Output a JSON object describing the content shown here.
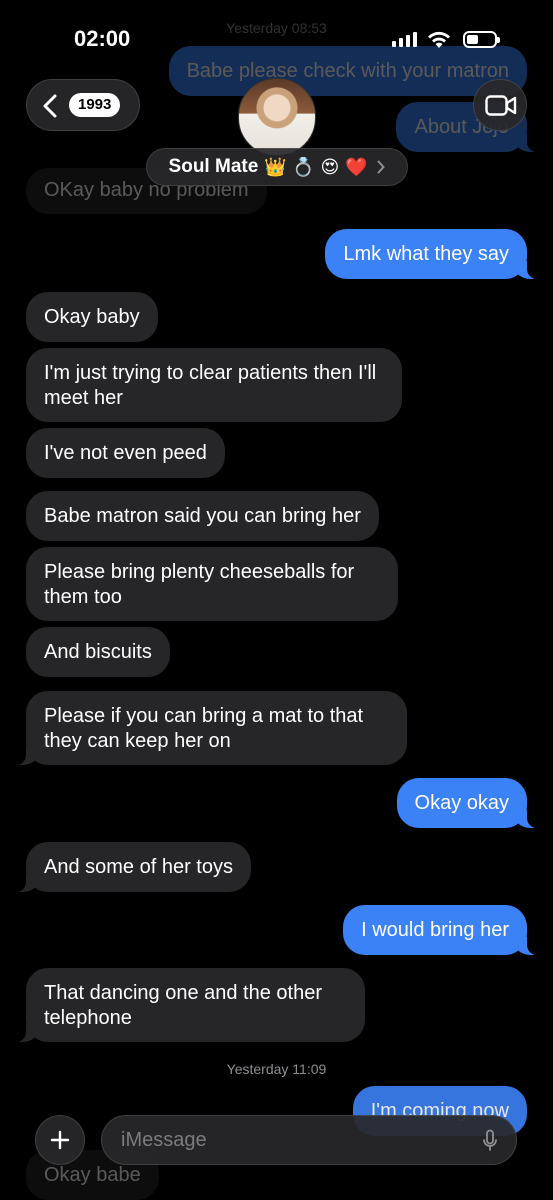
{
  "status_bar": {
    "time": "02:00"
  },
  "header": {
    "back_count": "1993",
    "contact_name": "Soul Mate",
    "contact_emojis": "👑 💍 😍 ❤️"
  },
  "timestamps": {
    "top": "Yesterday 08:53",
    "middle": "Yesterday 11:09"
  },
  "messages": {
    "m1": "Babe please check with your matron",
    "m2": "About Jojo",
    "m3": "OKay baby no problem",
    "m4": "Lmk what they say",
    "m5": "Okay baby",
    "m6": "I'm just trying to clear patients then I'll meet her",
    "m7": "I've not even peed",
    "m8": "Babe matron said you can bring her",
    "m9": "Please bring plenty cheeseballs for them too",
    "m10": "And biscuits",
    "m11": "Please if you can bring a mat to that they can keep her on",
    "m12": "Okay okay",
    "m13": "And some of her toys",
    "m14": "I would bring her",
    "m15": "That dancing one and the other telephone",
    "m16": "I'm coming now",
    "m17": "Okay babe"
  },
  "composer": {
    "placeholder": "iMessage"
  },
  "colors": {
    "outgoing": "#3b82f6",
    "incoming": "#262628",
    "background": "#000000"
  }
}
